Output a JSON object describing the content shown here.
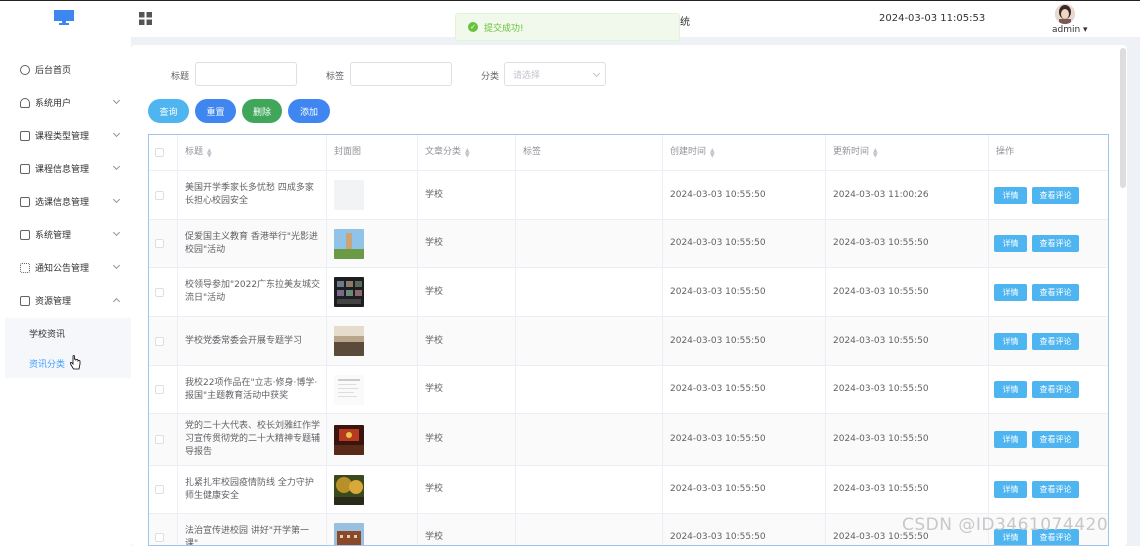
{
  "header": {
    "title_fragment": "统",
    "datetime": "2024-03-03 11:05:53",
    "username": "admin ▾"
  },
  "toast": {
    "message": "提交成功!"
  },
  "sidebar": {
    "items": [
      {
        "label": "后台首页",
        "icon": "clock-icon"
      },
      {
        "label": "系统用户",
        "icon": "user-icon"
      },
      {
        "label": "课程类型管理",
        "icon": "course-type-icon"
      },
      {
        "label": "课程信息管理",
        "icon": "course-info-icon"
      },
      {
        "label": "选课信息管理",
        "icon": "selection-icon"
      },
      {
        "label": "系统管理",
        "icon": "folder-icon"
      },
      {
        "label": "通知公告管理",
        "icon": "notice-icon"
      },
      {
        "label": "资源管理",
        "icon": "resource-icon"
      }
    ],
    "subitems": [
      {
        "label": "学校资讯"
      },
      {
        "label": "资讯分类"
      }
    ]
  },
  "search": {
    "title_label": "标题",
    "tag_label": "标签",
    "category_label": "分类",
    "category_placeholder": "请选择"
  },
  "buttons": {
    "query": "查询",
    "reset": "重置",
    "delete": "删除",
    "add": "添加"
  },
  "colors": {
    "query": "#4fb5f0",
    "reset": "#3f86f0",
    "delete": "#3fa65a",
    "add": "#3f86f0"
  },
  "table": {
    "headers": {
      "title": "标题",
      "cover": "封面图",
      "category": "文章分类",
      "tag": "标签",
      "created": "创建时间",
      "updated": "更新时间",
      "actions": "操作"
    },
    "detail_label": "详情",
    "comments_label": "查看评论",
    "rows": [
      {
        "title": "美国开学季家长多忧愁 四成多家长担心校园安全",
        "cover": "blank",
        "category": "学校",
        "tag": "",
        "created": "2024-03-03 10:55:50",
        "updated": "2024-03-03 11:00:26"
      },
      {
        "title": "促爱国主义教育 香港举行\"光影进校园\"活动",
        "cover": "tower",
        "category": "学校",
        "tag": "",
        "created": "2024-03-03 10:55:50",
        "updated": "2024-03-03 10:55:50"
      },
      {
        "title": "校领导参加\"2022广东拉美友城交流日\"活动",
        "cover": "meeting",
        "category": "学校",
        "tag": "",
        "created": "2024-03-03 10:55:50",
        "updated": "2024-03-03 10:55:50"
      },
      {
        "title": "学校党委常委会开展专题学习",
        "cover": "hall",
        "category": "学校",
        "tag": "",
        "created": "2024-03-03 10:55:50",
        "updated": "2024-03-03 10:55:50"
      },
      {
        "title": "我校22项作品在\"立志·修身·博学·报国\"主题教育活动中获奖",
        "cover": "doc",
        "category": "学校",
        "tag": "",
        "created": "2024-03-03 10:55:50",
        "updated": "2024-03-03 10:55:50"
      },
      {
        "title": "党的二十大代表、校长刘雅红作学习宣传贯彻党的二十大精神专题辅导报告",
        "cover": "stage",
        "category": "学校",
        "tag": "",
        "created": "2024-03-03 10:55:50",
        "updated": "2024-03-03 10:55:50"
      },
      {
        "title": "扎紧扎牢校园疫情防线 全力守护师生健康安全",
        "cover": "trees",
        "category": "学校",
        "tag": "",
        "created": "2024-03-03 10:55:50",
        "updated": "2024-03-03 10:55:50"
      },
      {
        "title": "法治宣传进校园 讲好\"开学第一课\"",
        "cover": "building",
        "category": "学校",
        "tag": "",
        "created": "2024-03-03 10:55:50",
        "updated": "2024-03-03 10:55:50"
      }
    ]
  },
  "watermark": "CSDN @ID3461074420"
}
